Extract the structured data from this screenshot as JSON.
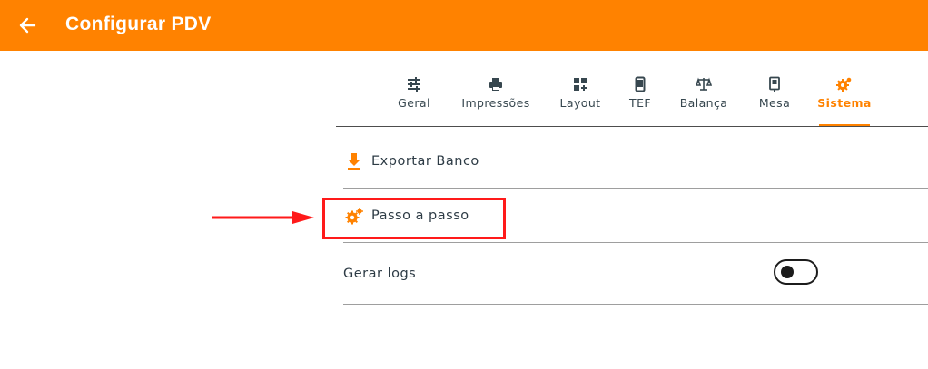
{
  "appbar": {
    "title": "Configurar PDV",
    "back_icon": "arrow-left-icon",
    "color": "#ff8200"
  },
  "tabs": [
    {
      "label": "Geral",
      "icon": "sliders-icon",
      "active": false
    },
    {
      "label": "Impressões",
      "icon": "printer-icon",
      "active": false
    },
    {
      "label": "Layout",
      "icon": "layout-add-icon",
      "active": false
    },
    {
      "label": "TEF",
      "icon": "phone-device-icon",
      "active": false
    },
    {
      "label": "Balança",
      "icon": "scale-icon",
      "active": false
    },
    {
      "label": "Mesa",
      "icon": "table-device-icon",
      "active": false
    },
    {
      "label": "Sistema",
      "icon": "gears-icon",
      "active": true
    }
  ],
  "settings": {
    "export_label": "Exportar Banco",
    "export_icon": "download-icon",
    "step_label": "Passo a passo",
    "step_icon": "gears-icon",
    "logs_label": "Gerar logs",
    "logs_enabled": false
  },
  "annotation": {
    "color": "#ff1a1a"
  }
}
